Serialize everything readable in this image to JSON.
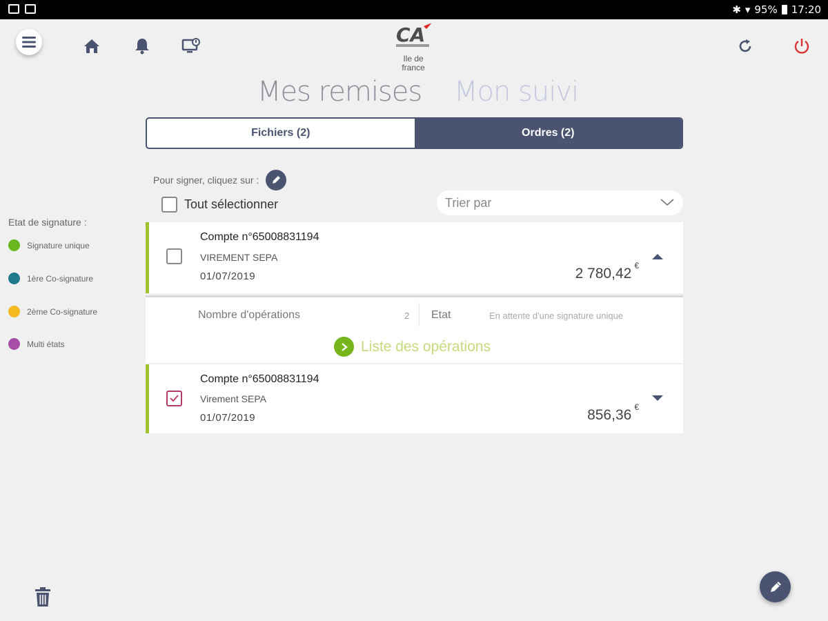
{
  "status_bar": {
    "battery": "95%",
    "time": "17:20"
  },
  "logo": {
    "mark": "CA",
    "line1": "Ile de",
    "line2": "france"
  },
  "tabs": {
    "mes_remises": "Mes remises",
    "mon_suivi": "Mon suivi"
  },
  "segments": {
    "fichiers": "Fichiers (2)",
    "ordres": "Ordres (2)",
    "selected": "Ordres (2)"
  },
  "hint": "Pour signer, cliquez sur :",
  "select_all": "Tout sélectionner",
  "sort": {
    "placeholder": "Trier par"
  },
  "legend": {
    "title": "Etat de signature :",
    "items": [
      {
        "label": "Signature unique",
        "color": "#6ab620"
      },
      {
        "label": "1ère Co-signature",
        "color": "#1f7a8c"
      },
      {
        "label": "2ème Co-signature",
        "color": "#f5b921"
      },
      {
        "label": "Multi états",
        "color": "#a84ea8"
      }
    ]
  },
  "orders": [
    {
      "account": "Compte n°65008831194",
      "type": "VIREMENT SEPA",
      "date": "01/07/2019",
      "amount": "2 780,42",
      "currency": "€",
      "checked": false,
      "expanded": true
    },
    {
      "account": "Compte n°65008831194",
      "type": "Virement SEPA",
      "date": "01/07/2019",
      "amount": "856,36",
      "currency": "€",
      "checked": true,
      "expanded": false
    }
  ],
  "detail": {
    "operations_label": "Nombre d'opérations",
    "operations_value": "2",
    "state_label": "Etat",
    "state_value": "En attente d'une signature unique",
    "link": "Liste des opérations"
  },
  "colors": {
    "primary": "#4a5470",
    "accent_green": "#9fc12e",
    "power_red": "#d33"
  }
}
